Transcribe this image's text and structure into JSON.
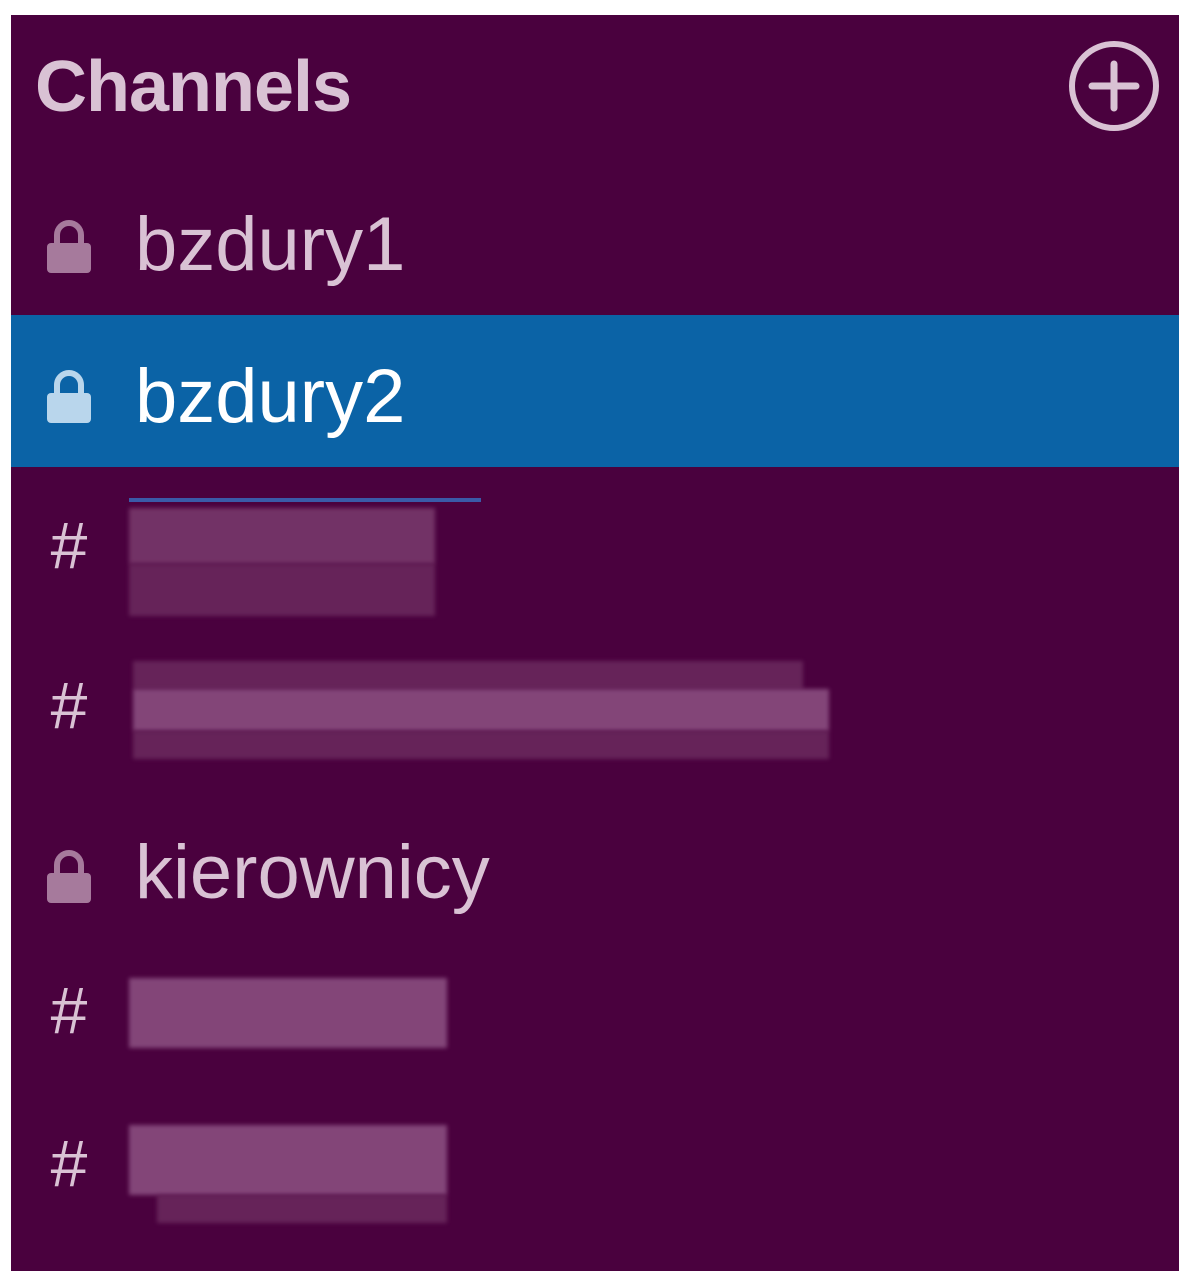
{
  "sidebar": {
    "section_title": "Channels",
    "add_button_icon": "plus-circle-icon",
    "colors": {
      "background": "#4a013e",
      "active_background": "#0b63a6",
      "text": "#d9c2d4",
      "active_text": "#ffffff"
    },
    "channels": [
      {
        "name": "bzdury1",
        "icon": "lock-icon",
        "active": false
      },
      {
        "name": "bzdury2",
        "icon": "lock-icon",
        "active": true
      },
      {
        "name": "",
        "icon": "hash-icon",
        "active": false,
        "redacted": true
      },
      {
        "name": "",
        "icon": "hash-icon",
        "active": false,
        "redacted": true
      },
      {
        "name": "kierownicy",
        "icon": "lock-icon",
        "active": false
      },
      {
        "name": "",
        "icon": "hash-icon",
        "active": false,
        "redacted": true
      },
      {
        "name": "",
        "icon": "hash-icon",
        "active": false,
        "redacted": true
      }
    ],
    "hash_glyph": "#"
  }
}
